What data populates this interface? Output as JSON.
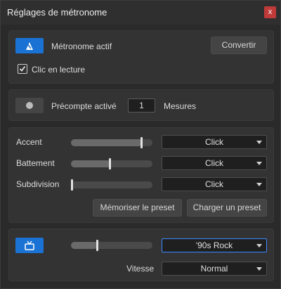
{
  "window": {
    "title": "Réglages de métronome",
    "close_label": "x"
  },
  "metronome": {
    "active_label": "Métronome actif",
    "convert_label": "Convertir",
    "click_playback_label": "Clic en lecture",
    "click_playback_checked": true,
    "icon": "metronome-icon"
  },
  "precount": {
    "label": "Précompte activé",
    "bars_value": "1",
    "bars_label": "Mesures",
    "enabled": false
  },
  "sounds": {
    "rows": [
      {
        "label": "Accent",
        "slider_level": 0.88,
        "select_value": "Click"
      },
      {
        "label": "Battement",
        "slider_level": 0.48,
        "select_value": "Click"
      },
      {
        "label": "Subdivision",
        "slider_level": 0.0,
        "select_value": "Click"
      }
    ],
    "save_preset_label": "Mémoriser le preset",
    "load_preset_label": "Charger un preset"
  },
  "style": {
    "icon": "tv-icon",
    "slider_level": 0.32,
    "preset_value": "'90s Rock",
    "speed_label": "Vitesse",
    "speed_value": "Normal"
  },
  "colors": {
    "accent_blue": "#1a72d4",
    "close_red": "#c03a3a",
    "focus_blue": "#3d8bff"
  }
}
